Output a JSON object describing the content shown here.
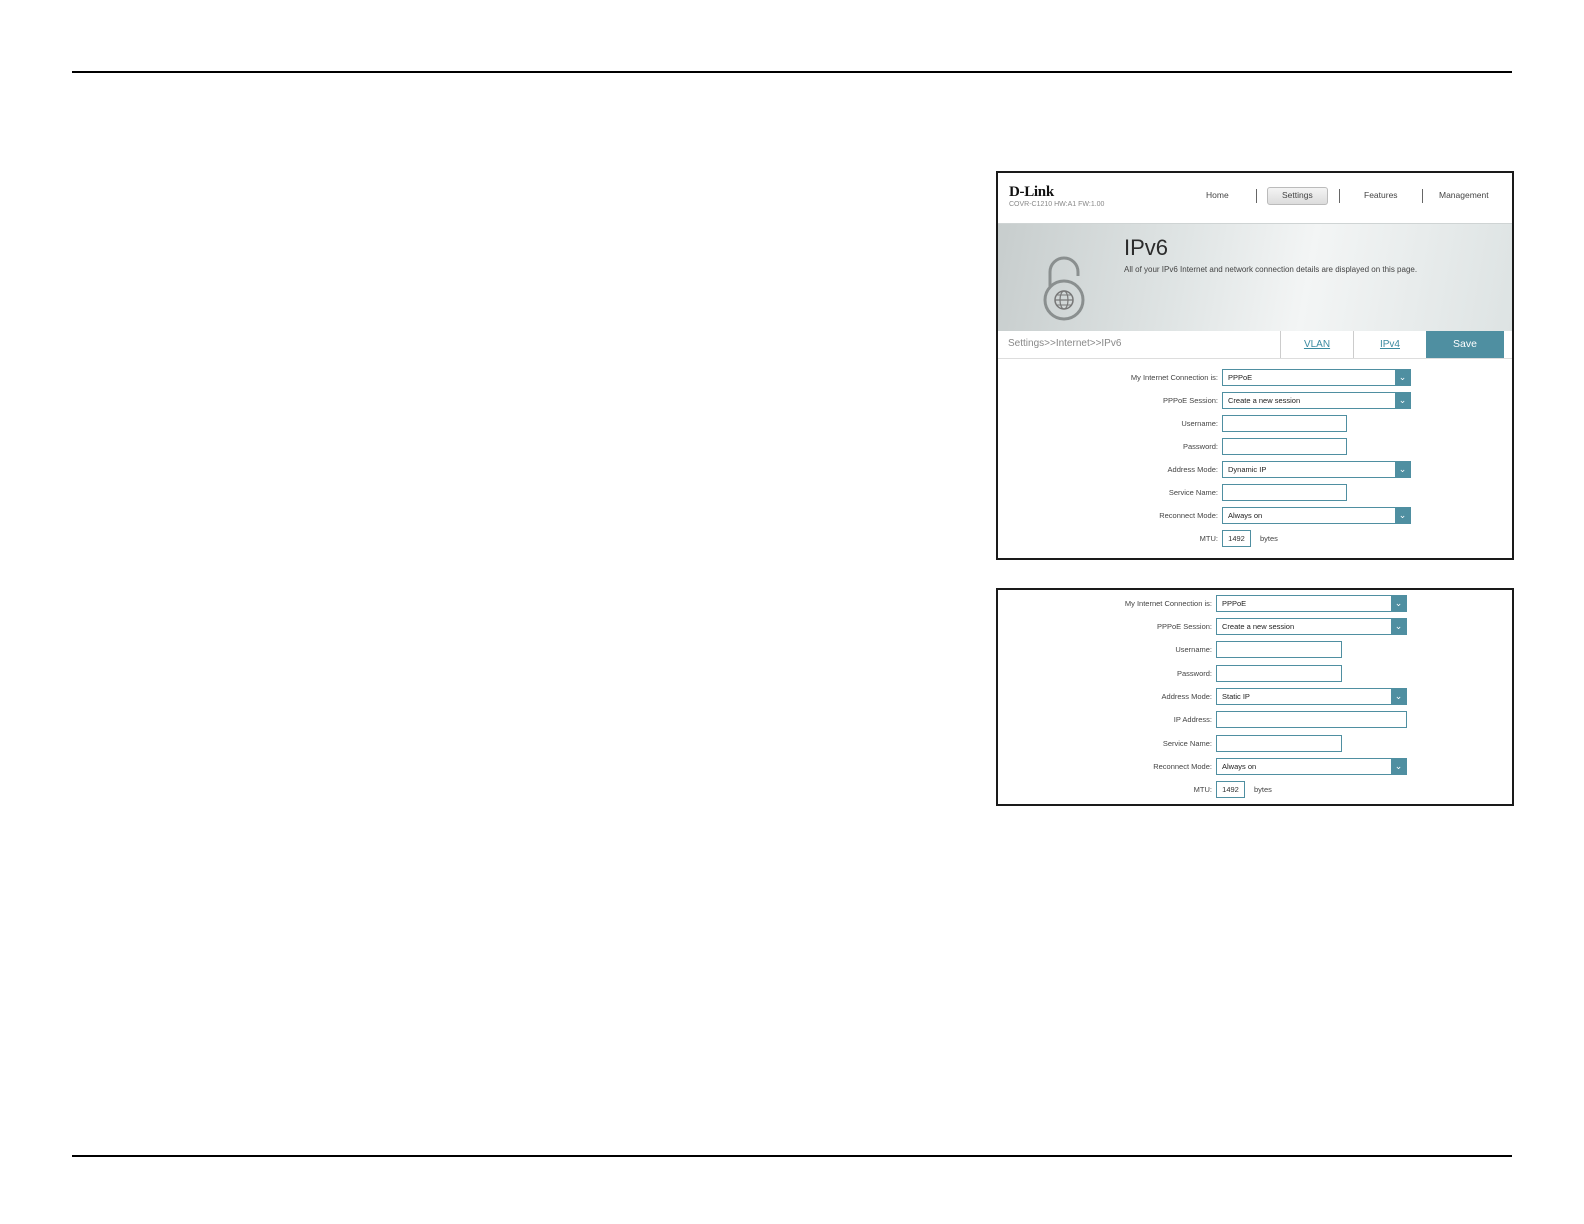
{
  "header": {
    "logo": "D-Link",
    "model_info": "COVR-C1210 HW:A1 FW:1.00",
    "nav": [
      "Home",
      "Settings",
      "Features",
      "Management"
    ],
    "active_nav": "Settings"
  },
  "banner": {
    "title": "IPv6",
    "description": "All of your IPv6 Internet and network connection details are displayed on this page.",
    "icon": "globe-lock-icon"
  },
  "toolbar": {
    "breadcrumb": "Settings>>Internet>>IPv6",
    "tab_vlan": "VLAN",
    "tab_ipv4": "IPv4",
    "save_label": "Save"
  },
  "form1": {
    "connection_label": "My Internet Connection is:",
    "connection_value": "PPPoE",
    "session_label": "PPPoE Session:",
    "session_value": "Create a new session",
    "username_label": "Username:",
    "password_label": "Password:",
    "address_mode_label": "Address Mode:",
    "address_mode_value": "Dynamic IP",
    "service_name_label": "Service Name:",
    "reconnect_label": "Reconnect Mode:",
    "reconnect_value": "Always on",
    "mtu_label": "MTU:",
    "mtu_value": "1492",
    "mtu_unit": "bytes"
  },
  "form2": {
    "connection_label": "My Internet Connection is:",
    "connection_value": "PPPoE",
    "session_label": "PPPoE Session:",
    "session_value": "Create a new session",
    "username_label": "Username:",
    "password_label": "Password:",
    "address_mode_label": "Address Mode:",
    "address_mode_value": "Static IP",
    "ip_address_label": "IP Address:",
    "service_name_label": "Service Name:",
    "reconnect_label": "Reconnect Mode:",
    "reconnect_value": "Always on",
    "mtu_label": "MTU:",
    "mtu_value": "1492",
    "mtu_unit": "bytes"
  },
  "colors": {
    "accent": "#4f8fa1",
    "link": "#3a8aa0"
  }
}
